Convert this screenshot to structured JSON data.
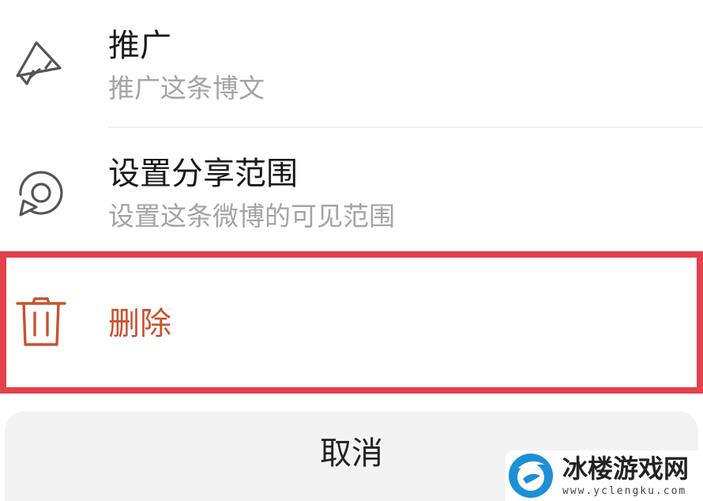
{
  "menu": {
    "promote": {
      "title": "推广",
      "subtitle": "推广这条博文",
      "icon": "megaphone-icon"
    },
    "share_scope": {
      "title": "设置分享范围",
      "subtitle": "设置这条微博的可见范围",
      "icon": "share-scope-icon"
    },
    "delete": {
      "title": "删除",
      "icon": "trash-icon"
    }
  },
  "cancel": {
    "label": "取消"
  },
  "watermark": {
    "name": "冰楼游戏网",
    "url": "www.yclengku.com"
  },
  "colors": {
    "delete_text": "#c85230",
    "highlight_border": "#e2414d",
    "subtitle_text": "#a4a4a4",
    "cancel_bg": "#f3f3f3",
    "watermark_logo": "#1c8fd6"
  }
}
